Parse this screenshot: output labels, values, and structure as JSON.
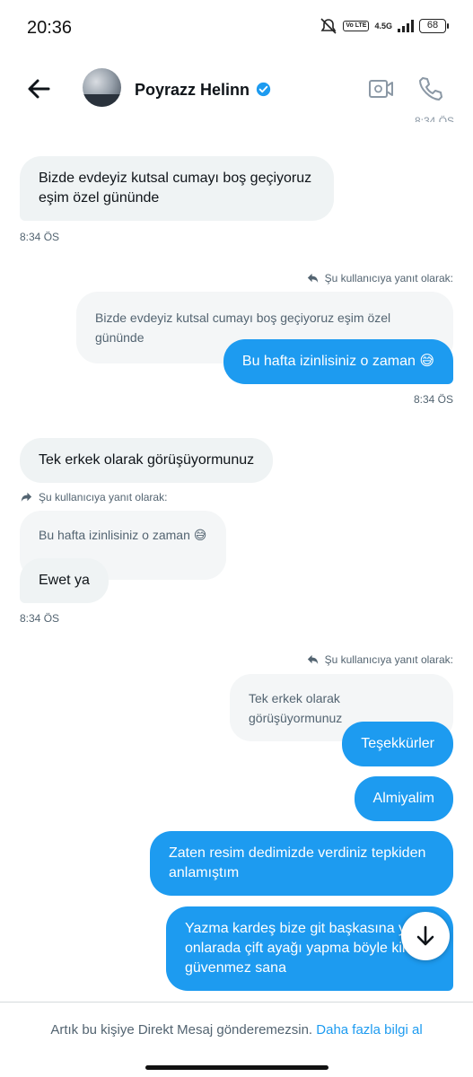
{
  "status_bar": {
    "time": "20:36",
    "volte": "Vo LTE",
    "network": "4.5G",
    "battery": "68"
  },
  "header": {
    "contact_name": "Poyrazz Helinn",
    "accent_color": "#1d9bf0",
    "icons": [
      "back-arrow-icon",
      "verified-badge-icon",
      "video-call-icon",
      "phone-icon"
    ]
  },
  "messages": [
    {
      "side": "in",
      "text": "Bizde evdeyiz kutsal cumayı boş geçiyoruz eşim özel gününde",
      "time": "8:34 ÖS"
    },
    {
      "side": "out",
      "reply_label": "Şu kullanıcıya yanıt olarak:",
      "quoted": "Bizde evdeyiz kutsal cumayı boş geçiyoruz eşim özel gününde",
      "text": "Bu hafta izinlisiniz o zaman 😅",
      "time": "8:34 ÖS"
    },
    {
      "side": "in",
      "text": "Tek erkek olarak görüşüyormunuz"
    },
    {
      "side": "in",
      "reply_label": "Şu kullanıcıya yanıt olarak:",
      "quoted": "Bu hafta izinlisiniz o zaman 😅",
      "text": "Ewet ya",
      "time": "8:34 ÖS"
    },
    {
      "side": "out",
      "reply_label": "Şu kullanıcıya yanıt olarak:",
      "quoted": "Tek erkek olarak görüşüyormunuz",
      "text": "Teşekkürler"
    },
    {
      "side": "out",
      "text": "Almiyalim"
    },
    {
      "side": "out",
      "text": "Zaten resim dedimizde verdiniz tepkiden anlamıştım"
    },
    {
      "side": "out",
      "text": "Yazma kardeş bize  git başkasına yaz onlarada çift ayağı yapma böyle kimse güvenmez sana"
    }
  ],
  "footer": {
    "notice": "Artık bu kişiye Direkt Mesaj gönderemezsin.",
    "link": "Daha fazla bilgi al"
  }
}
